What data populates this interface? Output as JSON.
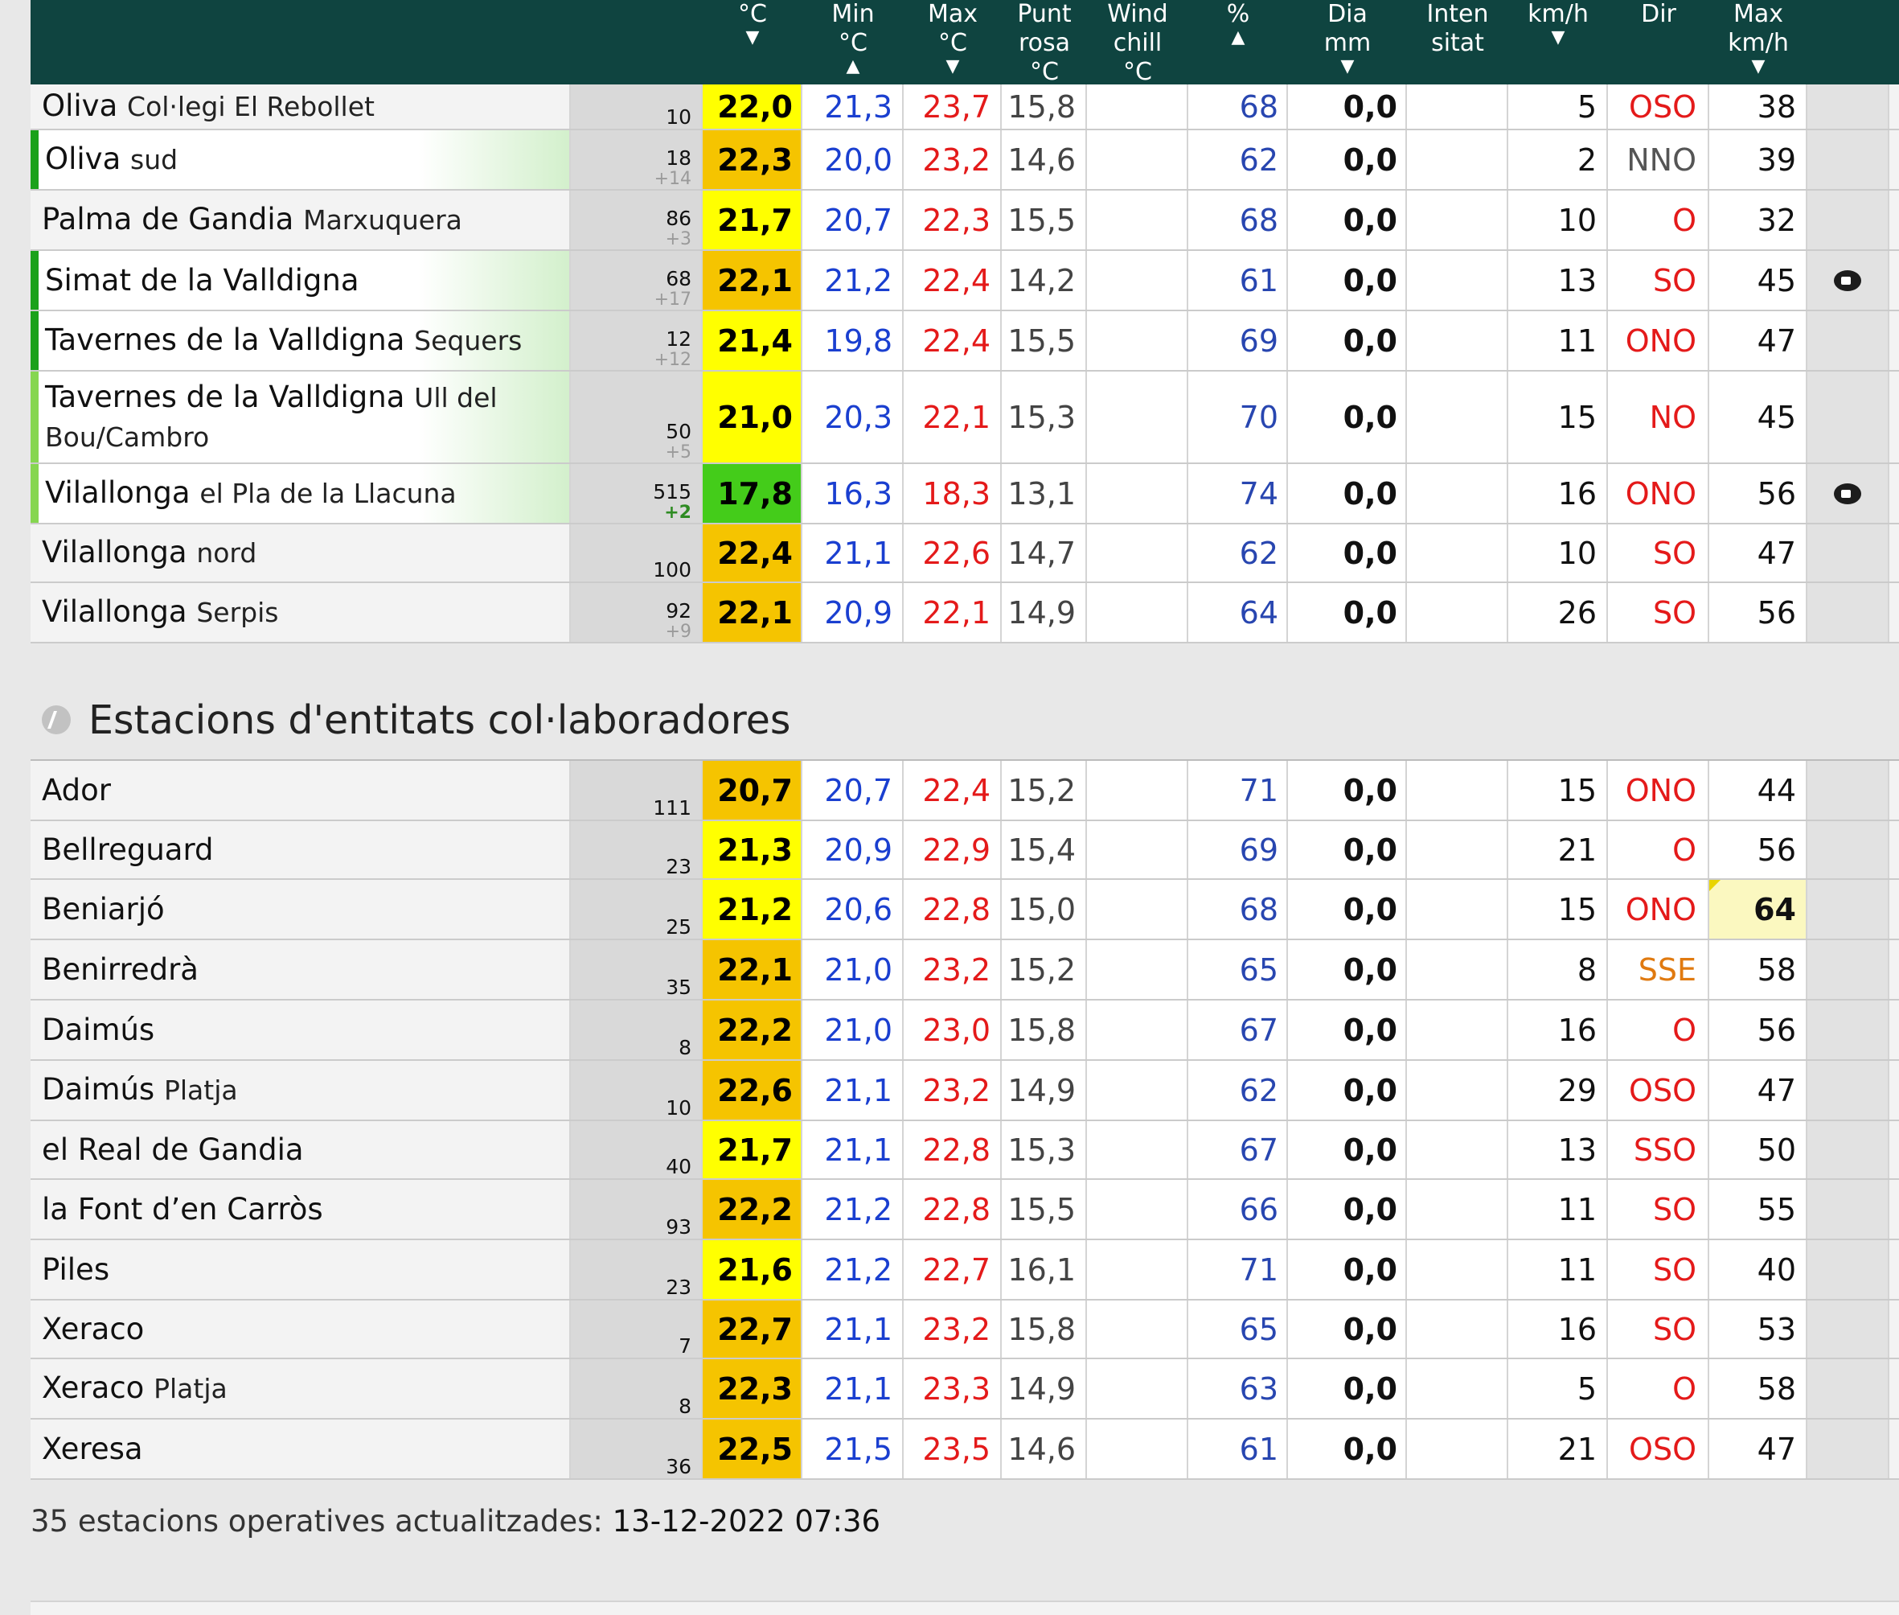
{
  "header": [
    {
      "l1": "",
      "l2": "°C",
      "arrow": "▼"
    },
    {
      "l1": "Min",
      "l2": "°C",
      "arrow": "▲"
    },
    {
      "l1": "Max",
      "l2": "°C",
      "arrow": "▼"
    },
    {
      "l1": "Punt",
      "l2": "rosa",
      "l3": "°C"
    },
    {
      "l1": "Wind",
      "l2": "chill",
      "l3": "°C"
    },
    {
      "l1": "",
      "l2": "%",
      "arrow": "▲"
    },
    {
      "l1": "Dia",
      "l2": "mm",
      "arrow": "▼"
    },
    {
      "l1": "Inten",
      "l2": "sitat"
    },
    {
      "l1": "km/h",
      "l2": "",
      "arrow": "▼"
    },
    {
      "l1": "Dir",
      "l2": ""
    },
    {
      "l1": "Max",
      "l2": "km/h",
      "arrow": "▼"
    }
  ],
  "colors": {
    "yellow": "#ffff00",
    "orange": "#f5c400",
    "green": "#44cc1a",
    "bar_dark": "#1aa11a",
    "bar_light": "#86d650",
    "blue": "#1a3fd0",
    "red": "#e41a1a",
    "dir_orange": "#e07a10"
  },
  "rows_a": [
    {
      "name": "Oliva",
      "sub": "Col·legi El Rebollet",
      "alt": "10",
      "diff": "",
      "t": "22,0",
      "tc": "yellow",
      "min": "21,3",
      "max": "23,7",
      "dew": "15,8",
      "hum": "68",
      "rain": "0,0",
      "ws": "5",
      "dir": "OSO",
      "dirc": "red",
      "gust": "38"
    },
    {
      "name": "Oliva",
      "sub": "sud",
      "alt": "18",
      "diff": "+14",
      "t": "22,3",
      "tc": "orange",
      "min": "20,0",
      "max": "23,2",
      "dew": "14,6",
      "hum": "62",
      "rain": "0,0",
      "ws": "2",
      "dir": "NNO",
      "dirc": "grey",
      "gust": "39",
      "bar": "dark"
    },
    {
      "name": "Palma de Gandia",
      "sub": "Marxuquera",
      "alt": "86",
      "diff": "+3",
      "t": "21,7",
      "tc": "yellow",
      "min": "20,7",
      "max": "22,3",
      "dew": "15,5",
      "hum": "68",
      "rain": "0,0",
      "ws": "10",
      "dir": "O",
      "dirc": "red",
      "gust": "32"
    },
    {
      "name": "Simat de la Valldigna",
      "sub": "",
      "alt": "68",
      "diff": "+17",
      "t": "22,1",
      "tc": "orange",
      "min": "21,2",
      "max": "22,4",
      "dew": "14,2",
      "hum": "61",
      "rain": "0,0",
      "ws": "13",
      "dir": "SO",
      "dirc": "red",
      "gust": "45",
      "bar": "dark",
      "cam": true
    },
    {
      "name": "Tavernes de la Valldigna",
      "sub": "Sequers",
      "alt": "12",
      "diff": "+12",
      "t": "21,4",
      "tc": "yellow",
      "min": "19,8",
      "max": "22,4",
      "dew": "15,5",
      "hum": "69",
      "rain": "0,0",
      "ws": "11",
      "dir": "ONO",
      "dirc": "red",
      "gust": "47",
      "bar": "dark"
    },
    {
      "name": "Tavernes de la Valldigna",
      "sub": "Ull del Bou/Cambro",
      "alt": "50",
      "diff": "+5",
      "t": "21,0",
      "tc": "yellow",
      "min": "20,3",
      "max": "22,1",
      "dew": "15,3",
      "hum": "70",
      "rain": "0,0",
      "ws": "15",
      "dir": "NO",
      "dirc": "red",
      "gust": "45",
      "bar": "light",
      "tall": true
    },
    {
      "name": "Vilallonga",
      "sub": "el Pla de la Llacuna",
      "alt": "515",
      "diff": "+2",
      "diffpos": true,
      "t": "17,8",
      "tc": "green",
      "min": "16,3",
      "max": "18,3",
      "dew": "13,1",
      "hum": "74",
      "rain": "0,0",
      "ws": "16",
      "dir": "ONO",
      "dirc": "red",
      "gust": "56",
      "bar": "light",
      "cam": true
    },
    {
      "name": "Vilallonga",
      "sub": "nord",
      "alt": "100",
      "diff": "",
      "t": "22,4",
      "tc": "orange",
      "min": "21,1",
      "max": "22,6",
      "dew": "14,7",
      "hum": "62",
      "rain": "0,0",
      "ws": "10",
      "dir": "SO",
      "dirc": "red",
      "gust": "47"
    },
    {
      "name": "Vilallonga",
      "sub": "Serpis",
      "alt": "92",
      "diff": "+9",
      "t": "22,1",
      "tc": "orange",
      "min": "20,9",
      "max": "22,1",
      "dew": "14,9",
      "hum": "64",
      "rain": "0,0",
      "ws": "26",
      "dir": "SO",
      "dirc": "red",
      "gust": "56"
    }
  ],
  "section_title": "Estacions d'entitats col·laboradores",
  "rows_b": [
    {
      "name": "Ador",
      "sub": "",
      "alt": "111",
      "diff": "",
      "t": "20,7",
      "tc": "orange",
      "min": "20,7",
      "max": "22,4",
      "dew": "15,2",
      "hum": "71",
      "rain": "0,0",
      "ws": "15",
      "dir": "ONO",
      "dirc": "red",
      "gust": "44"
    },
    {
      "name": "Bellreguard",
      "sub": "",
      "alt": "23",
      "diff": "",
      "t": "21,3",
      "tc": "yellow",
      "min": "20,9",
      "max": "22,9",
      "dew": "15,4",
      "hum": "69",
      "rain": "0,0",
      "ws": "21",
      "dir": "O",
      "dirc": "red",
      "gust": "56"
    },
    {
      "name": "Beniarjó",
      "sub": "",
      "alt": "25",
      "diff": "",
      "t": "21,2",
      "tc": "yellow",
      "min": "20,6",
      "max": "22,8",
      "dew": "15,0",
      "hum": "68",
      "rain": "0,0",
      "ws": "15",
      "dir": "ONO",
      "dirc": "red",
      "gust": "64",
      "alert": true
    },
    {
      "name": "Benirredrà",
      "sub": "",
      "alt": "35",
      "diff": "",
      "t": "22,1",
      "tc": "orange",
      "min": "21,0",
      "max": "23,2",
      "dew": "15,2",
      "hum": "65",
      "rain": "0,0",
      "ws": "8",
      "dir": "SSE",
      "dirc": "orange",
      "gust": "58"
    },
    {
      "name": "Daimús",
      "sub": "",
      "alt": "8",
      "diff": "",
      "t": "22,2",
      "tc": "orange",
      "min": "21,0",
      "max": "23,0",
      "dew": "15,8",
      "hum": "67",
      "rain": "0,0",
      "ws": "16",
      "dir": "O",
      "dirc": "red",
      "gust": "56"
    },
    {
      "name": "Daimús",
      "sub": "Platja",
      "alt": "10",
      "diff": "",
      "t": "22,6",
      "tc": "orange",
      "min": "21,1",
      "max": "23,2",
      "dew": "14,9",
      "hum": "62",
      "rain": "0,0",
      "ws": "29",
      "dir": "OSO",
      "dirc": "red",
      "gust": "47"
    },
    {
      "name": "el Real de Gandia",
      "sub": "",
      "alt": "40",
      "diff": "",
      "t": "21,7",
      "tc": "yellow",
      "min": "21,1",
      "max": "22,8",
      "dew": "15,3",
      "hum": "67",
      "rain": "0,0",
      "ws": "13",
      "dir": "SSO",
      "dirc": "red",
      "gust": "50"
    },
    {
      "name": "la Font d’en Carròs",
      "sub": "",
      "alt": "93",
      "diff": "",
      "t": "22,2",
      "tc": "orange",
      "min": "21,2",
      "max": "22,8",
      "dew": "15,5",
      "hum": "66",
      "rain": "0,0",
      "ws": "11",
      "dir": "SO",
      "dirc": "red",
      "gust": "55"
    },
    {
      "name": "Piles",
      "sub": "",
      "alt": "23",
      "diff": "",
      "t": "21,6",
      "tc": "yellow",
      "min": "21,2",
      "max": "22,7",
      "dew": "16,1",
      "hum": "71",
      "rain": "0,0",
      "ws": "11",
      "dir": "SO",
      "dirc": "red",
      "gust": "40"
    },
    {
      "name": "Xeraco",
      "sub": "",
      "alt": "7",
      "diff": "",
      "t": "22,7",
      "tc": "orange",
      "min": "21,1",
      "max": "23,2",
      "dew": "15,8",
      "hum": "65",
      "rain": "0,0",
      "ws": "16",
      "dir": "SO",
      "dirc": "red",
      "gust": "53"
    },
    {
      "name": "Xeraco",
      "sub": "Platja",
      "alt": "8",
      "diff": "",
      "t": "22,3",
      "tc": "orange",
      "min": "21,1",
      "max": "23,3",
      "dew": "14,9",
      "hum": "63",
      "rain": "0,0",
      "ws": "5",
      "dir": "O",
      "dirc": "red",
      "gust": "58"
    },
    {
      "name": "Xeresa",
      "sub": "",
      "alt": "36",
      "diff": "",
      "t": "22,5",
      "tc": "orange",
      "min": "21,5",
      "max": "23,5",
      "dew": "14,6",
      "hum": "61",
      "rain": "0,0",
      "ws": "21",
      "dir": "OSO",
      "dirc": "red",
      "gust": "47"
    }
  ],
  "footer": {
    "text": "35 estacions operatives actualitzades: ",
    "time": "13-12-2022 07:36"
  }
}
